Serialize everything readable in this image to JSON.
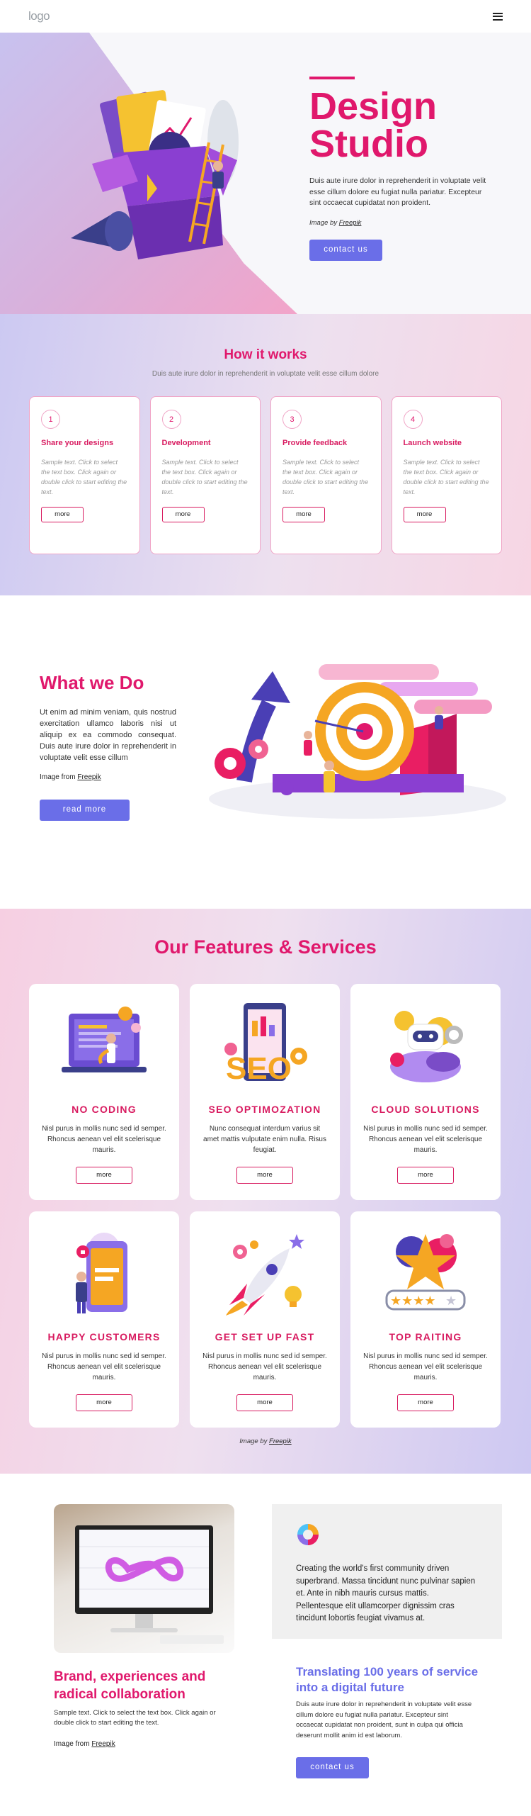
{
  "header": {
    "logo": "logo",
    "menu_icon": "hamburger-menu-icon"
  },
  "hero": {
    "title": "Design\nStudio",
    "description": "Duis aute irure dolor in reprehenderit in voluptate velit esse cillum dolore eu fugiat nulla pariatur. Excepteur sint occaecat cupidatat non proident.",
    "credit_prefix": "Image by",
    "credit_link": "Freepik",
    "button": "contact us"
  },
  "how": {
    "title": "How it works",
    "subtitle": "Duis aute irure dolor in reprehenderit in voluptate velit esse cillum dolore",
    "steps": [
      {
        "number": "1",
        "title": "Share your designs",
        "text": "Sample text. Click to select the text box. Click again or double click to start editing the text.",
        "button": "more"
      },
      {
        "number": "2",
        "title": "Development",
        "text": "Sample text. Click to select the text box. Click again or double click to start editing the text.",
        "button": "more"
      },
      {
        "number": "3",
        "title": "Provide feedback",
        "text": "Sample text. Click to select the text box. Click again or double click to start editing the text.",
        "button": "more"
      },
      {
        "number": "4",
        "title": "Launch website",
        "text": "Sample text. Click to select the text box. Click again or double click to start editing the text.",
        "button": "more"
      }
    ]
  },
  "what": {
    "title": "What we Do",
    "description": "Ut enim ad minim veniam, quis nostrud exercitation ullamco laboris nisi ut aliquip ex ea commodo consequat. Duis aute irure dolor in reprehenderit in voluptate velit esse cillum",
    "credit_prefix": "Image from",
    "credit_link": "Freepik",
    "button": "read more"
  },
  "features": {
    "title": "Our Features & Services",
    "items": [
      {
        "title": "NO CODING",
        "text": "Nisl purus in mollis nunc sed id semper. Rhoncus aenean vel elit scelerisque mauris.",
        "button": "more",
        "icon": "developer-laptop-icon"
      },
      {
        "title": "SEO OPTIMOZATION",
        "text": "Nunc consequat interdum varius sit amet mattis vulputate enim nulla. Risus feugiat.",
        "button": "more",
        "icon": "seo-chart-icon"
      },
      {
        "title": "CLOUD SOLUTIONS",
        "text": "Nisl purus in mollis nunc sed id semper. Rhoncus aenean vel elit scelerisque mauris.",
        "button": "more",
        "icon": "robot-cloud-icon"
      },
      {
        "title": "HAPPY CUSTOMERS",
        "text": "Nisl purus in mollis nunc sed id semper. Rhoncus aenean vel elit scelerisque mauris.",
        "button": "more",
        "icon": "phone-customer-icon"
      },
      {
        "title": "GET SET UP FAST",
        "text": "Nisl purus in mollis nunc sed id semper. Rhoncus aenean vel elit scelerisque mauris.",
        "button": "more",
        "icon": "rocket-launch-icon"
      },
      {
        "title": "TOP RAITING",
        "text": "Nisl purus in mollis nunc sed id semper. Rhoncus aenean vel elit scelerisque mauris.",
        "button": "more",
        "icon": "star-rating-icon"
      }
    ],
    "credit_prefix": "Image by",
    "credit_link": "Freepik"
  },
  "bottom": {
    "left_title": "Brand, experiences and radical collaboration",
    "left_text": "Sample text. Click to select the text box. Click again or double click to start editing the text.",
    "credit_prefix": "Image from",
    "credit_link": "Freepik",
    "box_text": "Creating the world's first community driven superbrand. Massa tincidunt nunc pulvinar sapien et. Ante in nibh mauris cursus mattis. Pellentesque elit ullamcorper dignissim cras tincidunt lobortis feugiat vivamus at.",
    "right_title": "Translating 100 years of service into a digital future",
    "right_text": "Duis aute irure dolor in reprehenderit in voluptate velit esse cillum dolore eu fugiat nulla pariatur. Excepteur sint occaecat cupidatat non proident, sunt in culpa qui officia deserunt mollit anim id est laborum.",
    "button": "contact us"
  },
  "colors": {
    "accent": "#e0186c",
    "primary_button": "#6a6ee8"
  }
}
